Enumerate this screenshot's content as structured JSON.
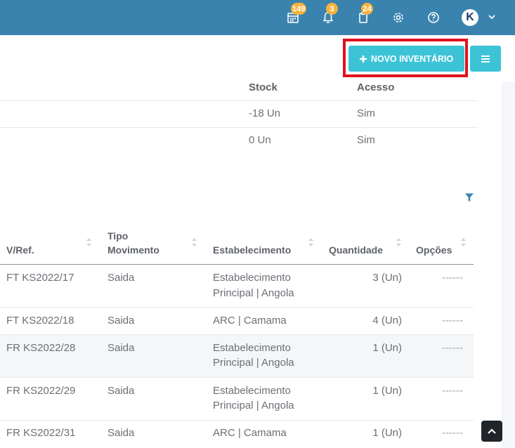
{
  "navbar": {
    "badges": {
      "calendar": "149",
      "notifications": "3",
      "clipboard": "24"
    },
    "avatar_letter": "K"
  },
  "toolbar": {
    "new_inventory_label": "NOVO INVENTÁRIO"
  },
  "stock_table": {
    "headers": {
      "stock": "Stock",
      "access": "Acesso"
    },
    "rows": [
      {
        "stock": "-18 Un",
        "access": "Sim"
      },
      {
        "stock": "0 Un",
        "access": "Sim"
      }
    ]
  },
  "movements_table": {
    "headers": {
      "ref": "V/Ref.",
      "type_line1": "Tipo",
      "type_line2": "Movimento",
      "establishment": "Estabelecimento",
      "quantity": "Quantidade",
      "options": "Opções"
    },
    "rows": [
      {
        "ref": "FT KS2022/17",
        "type": "Saida",
        "est1": "Estabelecimento",
        "est2": "Principal | Angola",
        "qty": "3 (Un)",
        "opt": "------"
      },
      {
        "ref": "FT KS2022/18",
        "type": "Saida",
        "est1": "ARC | Camama",
        "est2": "",
        "qty": "4 (Un)",
        "opt": "------"
      },
      {
        "ref": "FR KS2022/28",
        "type": "Saida",
        "est1": "Estabelecimento",
        "est2": "Principal | Angola",
        "qty": "1 (Un)",
        "opt": "------"
      },
      {
        "ref": "FR KS2022/29",
        "type": "Saida",
        "est1": "Estabelecimento",
        "est2": "Principal | Angola",
        "qty": "1 (Un)",
        "opt": "------"
      },
      {
        "ref": "FR KS2022/31",
        "type": "Saida",
        "est1": "ARC | Camama",
        "est2": "",
        "qty": "1 (Un)",
        "opt": "------"
      }
    ]
  },
  "colors": {
    "navbar": "#3a83ae",
    "accent": "#3cc4d6",
    "highlight": "#e0121b",
    "badge": "#f4b33d"
  }
}
